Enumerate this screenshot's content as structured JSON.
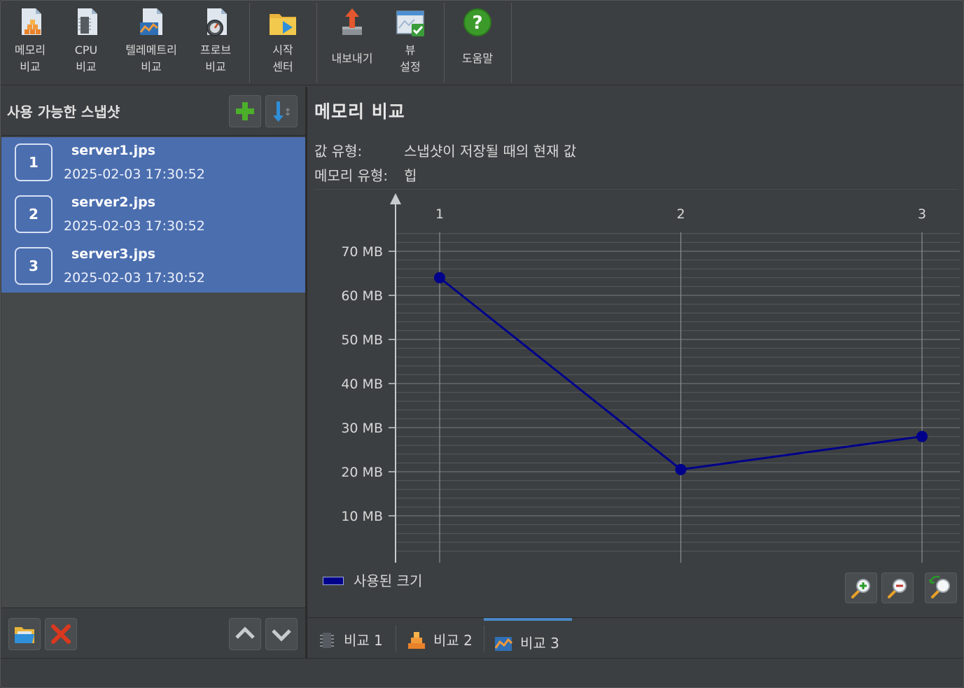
{
  "toolbar": {
    "items": [
      {
        "label": "메모리\n비교",
        "icon": "memory-compare-icon"
      },
      {
        "label": "CPU\n비교",
        "icon": "cpu-compare-icon"
      },
      {
        "label": "텔레메트리\n비교",
        "icon": "telemetry-compare-icon"
      },
      {
        "label": "프로브\n비교",
        "icon": "probe-compare-icon"
      },
      {
        "label": "시작\n센터",
        "icon": "start-center-icon"
      },
      {
        "label": "내보내기",
        "icon": "export-icon"
      },
      {
        "label": "뷰\n설정",
        "icon": "view-settings-icon"
      },
      {
        "label": "도움말",
        "icon": "help-icon"
      }
    ]
  },
  "left_panel": {
    "title": "사용 가능한 스냅샷",
    "snapshots": [
      {
        "num": "1",
        "name": "server1.jps",
        "date": "2025-02-03 17:30:52"
      },
      {
        "num": "2",
        "name": "server2.jps",
        "date": "2025-02-03 17:30:52"
      },
      {
        "num": "3",
        "name": "server3.jps",
        "date": "2025-02-03 17:30:52"
      }
    ]
  },
  "main": {
    "title": "메모리 비교",
    "value_type_label": "값 유형:",
    "value_type": "스냅샷이 저장될 때의 현재 값",
    "memory_type_label": "메모리 유형:",
    "memory_type": "힙"
  },
  "chart_data": {
    "type": "line",
    "x": [
      1,
      2,
      3
    ],
    "x_tick_labels": [
      "1",
      "2",
      "3"
    ],
    "series": [
      {
        "name": "사용된 크기",
        "values": [
          64,
          20.5,
          28
        ],
        "color": "#00008b"
      }
    ],
    "ylim": [
      0,
      75
    ],
    "y_ticks": [
      10,
      20,
      30,
      40,
      50,
      60,
      70
    ],
    "y_tick_labels": [
      "10 MB",
      "20 MB",
      "30 MB",
      "40 MB",
      "50 MB",
      "60 MB",
      "70 MB"
    ],
    "grid": true,
    "legend_position": "bottom-left"
  },
  "tabs": [
    {
      "label": "비교 1",
      "icon": "cpu-compare-icon",
      "active": false
    },
    {
      "label": "비교 2",
      "icon": "memory-compare-icon",
      "active": false
    },
    {
      "label": "비교 3",
      "icon": "telemetry-compare-icon",
      "active": true
    }
  ],
  "colors": {
    "background": "#3c3f41",
    "selection": "#4b6eaf",
    "series": "#00008b",
    "active_tab": "#4a88c7"
  }
}
